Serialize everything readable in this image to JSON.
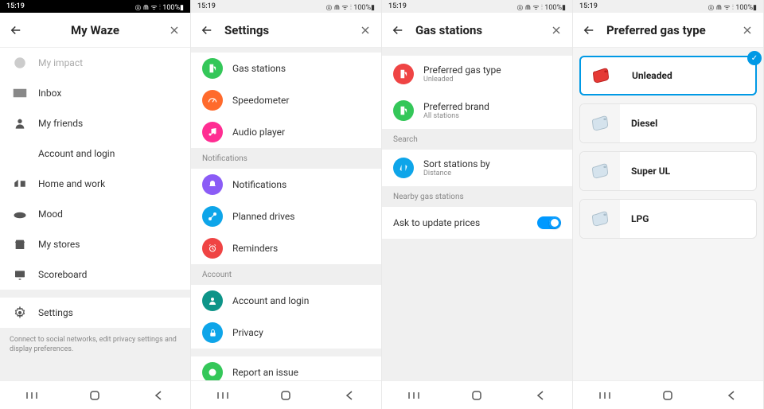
{
  "status": {
    "time": "15:19",
    "right": "◎ ⋒ ᯤ ⫶ 100%▮"
  },
  "screen1": {
    "title": "My Waze",
    "items": [
      {
        "label": "My impact",
        "dim": true
      },
      {
        "label": "Inbox"
      },
      {
        "label": "My friends"
      },
      {
        "label": "Account and login"
      },
      {
        "label": "Home and work"
      },
      {
        "label": "Mood"
      },
      {
        "label": "My stores"
      },
      {
        "label": "Scoreboard"
      }
    ],
    "settings_label": "Settings",
    "hint": "Connect to social networks, edit privacy settings and display preferences."
  },
  "screen2": {
    "title": "Settings",
    "rows": [
      {
        "label": "Gas stations",
        "color": "#34c759",
        "icon": "pump"
      },
      {
        "label": "Speedometer",
        "color": "#ff6a2c",
        "icon": "speed"
      },
      {
        "label": "Audio player",
        "color": "#ff2d92",
        "icon": "music"
      }
    ],
    "notif_header": "Notifications",
    "notif_rows": [
      {
        "label": "Notifications",
        "color": "#8b5cf6",
        "icon": "bell"
      },
      {
        "label": "Planned drives",
        "color": "#0ea5e9",
        "icon": "route"
      },
      {
        "label": "Reminders",
        "color": "#ef4444",
        "icon": "clock"
      }
    ],
    "acct_header": "Account",
    "acct_rows": [
      {
        "label": "Account and login",
        "color": "#0d9488",
        "icon": "user"
      },
      {
        "label": "Privacy",
        "color": "#0ea5e9",
        "icon": "lock"
      }
    ],
    "last_label": "Report an issue"
  },
  "screen3": {
    "title": "Gas stations",
    "pref_rows": [
      {
        "main": "Preferred gas type",
        "sub": "Unleaded",
        "color": "#ef4444",
        "icon": "pump"
      },
      {
        "main": "Preferred brand",
        "sub": "All stations",
        "color": "#34c759",
        "icon": "pump"
      }
    ],
    "search_header": "Search",
    "sort_row": {
      "main": "Sort stations by",
      "sub": "Distance",
      "color": "#0ea5e9",
      "icon": "sort"
    },
    "nearby_header": "Nearby gas stations",
    "ask_label": "Ask to update prices"
  },
  "screen4": {
    "title": "Preferred gas type",
    "options": [
      {
        "label": "Unleaded",
        "selected": true
      },
      {
        "label": "Diesel",
        "selected": false
      },
      {
        "label": "Super UL",
        "selected": false
      },
      {
        "label": "LPG",
        "selected": false
      }
    ]
  }
}
